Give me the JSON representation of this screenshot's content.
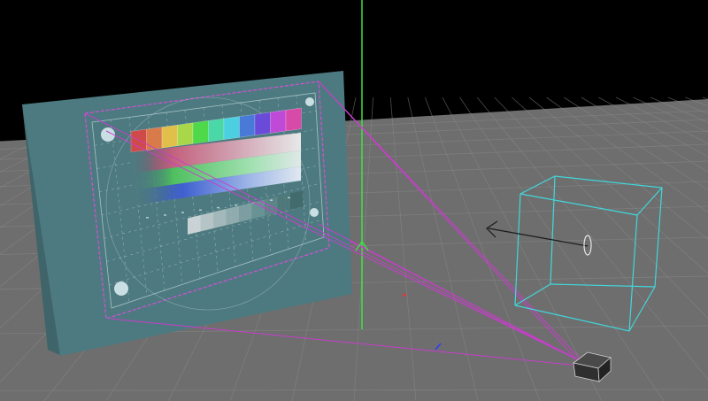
{
  "viewport": {
    "name": "3d-viewport",
    "colors": {
      "background": "#000000",
      "floor": "#6e6e6e",
      "grid_line": "#8a8a8a",
      "wall": "#4d7a80",
      "wall_side": "#3f6469",
      "projection_border": "#d64fd6",
      "frustum": "#c83dcc",
      "cube_wire": "#41d7dc",
      "axis_y": "#3ee33e",
      "axis_z": "#2a3cff",
      "origin_point": "#e03a3a",
      "projector_body": "#2f2f2f",
      "arrow": "#1a1a1a"
    }
  },
  "test_pattern": {
    "color_bars": [
      "#d04a4a",
      "#d97a4a",
      "#e0c04a",
      "#a8d84a",
      "#4ed84a",
      "#4ad8a8",
      "#4ad0e0",
      "#4a7ad8",
      "#6a4ad8",
      "#c04ad8",
      "#d84aa8"
    ],
    "gray_steps": [
      "#e8e8e8",
      "#d0d8d8",
      "#b8c8c8",
      "#a0b8b8",
      "#88a8a8",
      "#709898",
      "#608888",
      "#507878",
      "#406868"
    ]
  },
  "objects": [
    {
      "name": "projector",
      "icon": "projector-icon"
    },
    {
      "name": "light-cube-gizmo",
      "icon": "cube-wireframe-icon"
    },
    {
      "name": "projection-wall",
      "icon": "plane-icon"
    }
  ]
}
